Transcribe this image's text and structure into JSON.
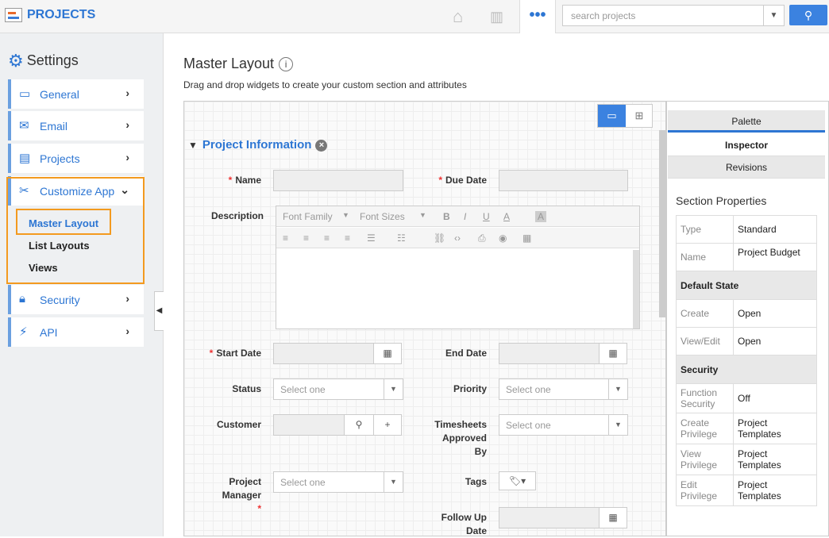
{
  "app": {
    "title": "PROJECTS",
    "search_placeholder": "search projects"
  },
  "sidebar": {
    "title": "Settings",
    "items": [
      {
        "label": "General"
      },
      {
        "label": "Email"
      },
      {
        "label": "Projects"
      },
      {
        "label": "Customize App"
      },
      {
        "label": "Security"
      },
      {
        "label": "API"
      }
    ],
    "sub": [
      "Master Layout",
      "List Layouts",
      "Views"
    ]
  },
  "page": {
    "title": "Master Layout",
    "subtitle": "Drag and drop widgets to create your custom section and attributes"
  },
  "section": {
    "title": "Project Information"
  },
  "fields": {
    "name": "Name",
    "due_date": "Due Date",
    "description": "Description",
    "start_date": "Start Date",
    "end_date": "End Date",
    "status": "Status",
    "priority": "Priority",
    "customer": "Customer",
    "timesheets": [
      "Timesheets",
      "Approved",
      "By"
    ],
    "pm": [
      "Project",
      "Manager"
    ],
    "tags": "Tags",
    "followup": [
      "Follow Up",
      "Date"
    ],
    "select_placeholder": "Select one"
  },
  "rte": {
    "font_family": "Font Family",
    "font_sizes": "Font Sizes"
  },
  "rpanel": {
    "tabs": [
      "Palette",
      "Inspector",
      "Revisions"
    ],
    "props_title": "Section Properties",
    "rows": [
      {
        "k": "Type",
        "v": "Standard"
      },
      {
        "k": "Name",
        "v": "Project Budget"
      },
      {
        "h": "Default State"
      },
      {
        "k": "Create",
        "v": "Open"
      },
      {
        "k": "View/Edit",
        "v": "Open"
      },
      {
        "h": "Security"
      },
      {
        "k": "Function Security",
        "v": "Off"
      },
      {
        "k": "Create Privilege",
        "v": "Project Templates"
      },
      {
        "k": "View Privilege",
        "v": "Project Templates"
      },
      {
        "k": "Edit Privilege",
        "v": "Project Templates"
      }
    ]
  }
}
